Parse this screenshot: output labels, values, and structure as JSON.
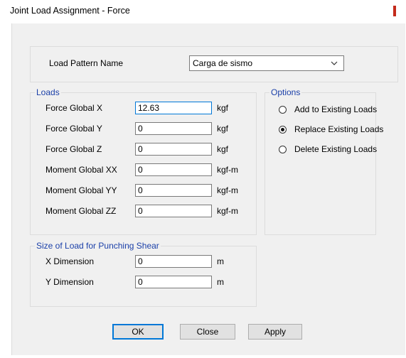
{
  "window": {
    "title": "Joint Load Assignment - Force"
  },
  "colors": {
    "accent_close": "#c42b1c",
    "legend_text": "#1a3fa8",
    "focus_border": "#0078d7"
  },
  "load_pattern": {
    "label": "Load Pattern Name",
    "selected": "Carga de sismo"
  },
  "loads": {
    "legend": "Loads",
    "rows": [
      {
        "label": "Force Global X",
        "value": "12.63",
        "unit": "kgf"
      },
      {
        "label": "Force Global Y",
        "value": "0",
        "unit": "kgf"
      },
      {
        "label": "Force Global Z",
        "value": "0",
        "unit": "kgf"
      },
      {
        "label": "Moment Global XX",
        "value": "0",
        "unit": "kgf-m"
      },
      {
        "label": "Moment Global YY",
        "value": "0",
        "unit": "kgf-m"
      },
      {
        "label": "Moment Global ZZ",
        "value": "0",
        "unit": "kgf-m"
      }
    ]
  },
  "options": {
    "legend": "Options",
    "items": [
      {
        "label": "Add to Existing Loads",
        "selected": false
      },
      {
        "label": "Replace Existing Loads",
        "selected": true
      },
      {
        "label": "Delete Existing Loads",
        "selected": false
      }
    ]
  },
  "punching": {
    "legend": "Size of Load for Punching Shear",
    "rows": [
      {
        "label": "X Dimension",
        "value": "0",
        "unit": "m"
      },
      {
        "label": "Y Dimension",
        "value": "0",
        "unit": "m"
      }
    ]
  },
  "buttons": {
    "ok": "OK",
    "close": "Close",
    "apply": "Apply"
  }
}
